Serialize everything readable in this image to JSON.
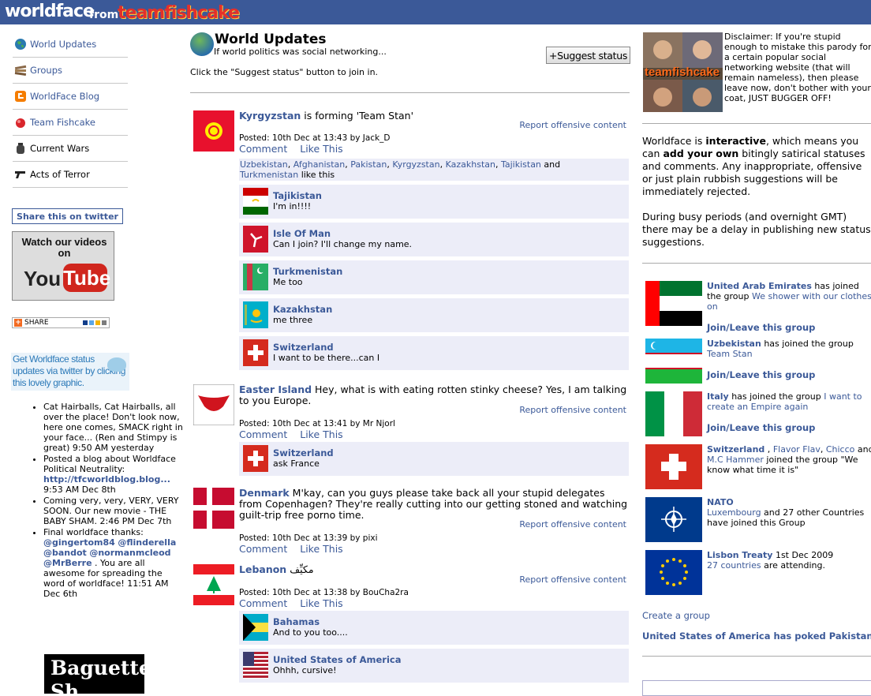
{
  "header": {
    "logo_main": "worldface",
    "logo_from": "from",
    "logo_brand": "teamfishcake"
  },
  "nav": [
    {
      "label": "World Updates",
      "icon": "globe-icon"
    },
    {
      "label": "Groups",
      "icon": "groups-icon"
    },
    {
      "label": "WorldFace Blog",
      "icon": "blogger-icon"
    },
    {
      "label": "Team Fishcake",
      "icon": "fishcake-icon"
    },
    {
      "label": "Current Wars",
      "icon": "grenade-icon"
    },
    {
      "label": "Acts of Terror",
      "icon": "gun-icon"
    }
  ],
  "left": {
    "share_twitter": "Share this on twitter",
    "yt_watch": "Watch our videos on",
    "yt_you": "You",
    "yt_tube": "Tube",
    "share_label": "SHARE",
    "twitter_promo": "Get Worldface status updates via twitter by clicking this lovely graphic.",
    "tweets": {
      "t1": "Cat Hairballs, Cat Hairballs, all over the place! Don't look now, here one comes, SMACK right in your face... (Ren and Stimpy is great) 9:50 AM yesterday",
      "t2a": "Posted a blog about Worldface Political Neutrality: ",
      "t2link": "http://tfcworldblog.blog...",
      "t2b": " 9:53 AM Dec 8th",
      "t3": "Coming very, very, VERY, VERY SOON. Our new movie - THE BABY SHAM. 2:46 PM Dec 7th",
      "t4a": "Final worldface thanks: ",
      "h1": "@gingertom84",
      "h2": "@flinderella",
      "h3": "@bandot",
      "h4": "@normanmcleod",
      "h5": "@MrBerre",
      "t4b": " . You are all awesome for spreading the word of worldface! 11:51 AM Dec 6th"
    },
    "baguette": "Baguette Sh"
  },
  "main": {
    "title": "World Updates",
    "subtitle": "If world politics was social networking...",
    "suggest_button": "+Suggest status",
    "click_note": "Click the \"Suggest status\" button to join in.",
    "report_label": "Report offensive content",
    "comment_label": "Comment",
    "like_label": "Like This",
    "posts": [
      {
        "who": "Kyrgyzstan",
        "text": " is forming 'Team Stan'",
        "posted": "Posted: 10th Dec at 13:43 by Jack_D",
        "likes": {
          "countries": [
            "Uzbekistan",
            "Afghanistan",
            "Pakistan",
            "Kyrgyzstan",
            "Kazakhstan",
            "Tajikistan"
          ],
          "and": "and",
          "last": "Turkmenistan",
          "suffix": "like this"
        },
        "comments": [
          {
            "who": "Tajikistan",
            "text": "I'm in!!!!"
          },
          {
            "who": "Isle Of Man",
            "text": "Can I join? I'll change my name."
          },
          {
            "who": "Turkmenistan",
            "text": "Me too"
          },
          {
            "who": "Kazakhstan",
            "text": "me three"
          },
          {
            "who": "Switzerland",
            "text": "I want to be there...can I"
          }
        ]
      },
      {
        "who": "Easter Island",
        "text": " Hey, what is with eating rotten stinky cheese? Yes, I am talking to you Europe.",
        "posted": "Posted: 10th Dec at 13:41 by Mr Njorl",
        "comments": [
          {
            "who": "Switzerland",
            "text": "ask France"
          }
        ]
      },
      {
        "who": "Denmark",
        "text": " M'kay, can you guys please take back all your stupid delegates from Copenhagen? They're really cutting into our getting stoned and watching guilt-trip free porno time.",
        "posted": "Posted: 10th Dec at 13:39 by pixi"
      },
      {
        "who": "Lebanon",
        "text": " مكيِّف",
        "posted": "Posted: 10th Dec at 13:38 by BouCha2ra",
        "comments": [
          {
            "who": "Bahamas",
            "text": "And to you too...."
          },
          {
            "who": "United States of America",
            "text": "Ohhh, cursive!"
          }
        ]
      }
    ]
  },
  "right": {
    "disclaimer": "Disclaimer: If you're stupid enough to mistake this parody for a certain popular social networking website (that will remain nameless), then please leave now, don't bother with your coat, JUST BUGGER OFF!",
    "tf_caption": "teamfishcake",
    "inter": {
      "a": "Worldface is ",
      "b": "interactive",
      "c": ", which means you can ",
      "d": "add your own",
      "e": " bitingly satirical statuses and comments. Any inappropriate, offensive or just plain rubbish suggestions will be immediately rejected.",
      "f": "During busy periods (and overnight GMT) there may be a delay in publishing new status suggestions."
    },
    "join_label": "Join/Leave this group",
    "groups": {
      "g1": {
        "who": "United Arab Emirates",
        "mid": " has joined the group ",
        "grp": "We shower with our clothes on"
      },
      "g2": {
        "who": "Uzbekistan",
        "mid": " has joined the group ",
        "grp": "Team Stan"
      },
      "g3": {
        "who": "Italy",
        "mid": " has joined the group ",
        "grp": "I want to create an Empire again"
      },
      "g4": {
        "who": "Switzerland",
        "s1": " , ",
        "p2": "Flavor Flav",
        "s2": ", ",
        "p3": "Chicco",
        "s3": " and ",
        "p4": "M.C Hammer",
        "tail": " joined the group \"We know what time it is\""
      },
      "g5": {
        "who": "NATO",
        "p2": "Luxembourg",
        "tail": " and 27 other Countries have joined this Group"
      },
      "g6": {
        "who": "Lisbon Treaty",
        "date": " 1st Dec 2009",
        "p2": "27 countries",
        "tail": " are attending."
      }
    },
    "create_group": "Create a group",
    "poked": "United States of America has poked Pakistan"
  },
  "colors": {
    "brand": "#3b5998",
    "comment_bg": "#ecedf8"
  }
}
